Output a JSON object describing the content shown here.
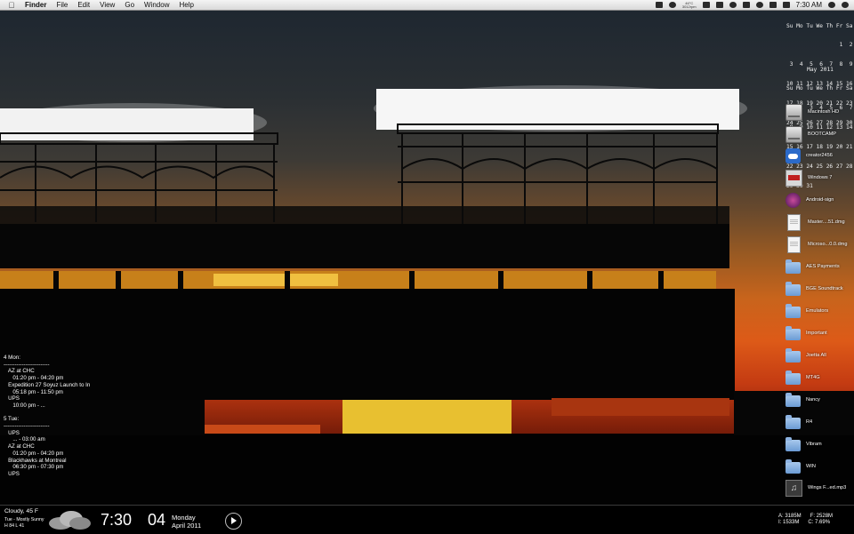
{
  "menubar": {
    "app_name": "Finder",
    "menus": [
      "File",
      "Edit",
      "View",
      "Go",
      "Window",
      "Help"
    ],
    "temp_line1": "46°C",
    "temp_line2": "3012rpm",
    "clock": "7:30 AM"
  },
  "calendars": [
    {
      "title": "",
      "header": "Su Mo Tu We Th Fr Sa",
      "weeks": [
        "                1  2",
        " 3  4  5  6  7  8  9",
        "10 11 12 13 14 15 16",
        "17 18 19 20 21 22 23",
        "24 25 26 27 28 29 30"
      ]
    },
    {
      "title": "May 2011",
      "header": "Su Mo Tu We Th Fr Sa",
      "weeks": [
        " 1  2  3  4  5  6  7",
        " 8  9 10 11 12 13 14",
        "15 16 17 18 19 20 21",
        "22 23 24 25 26 27 28",
        "29 30 31"
      ]
    }
  ],
  "desktop_icons": [
    {
      "label": "Macintosh HD",
      "icon": "hard-drive-icon"
    },
    {
      "label": "BOOTCAMP",
      "icon": "hard-drive-icon"
    },
    {
      "label": "creator2456",
      "icon": "cloud-drive-icon"
    },
    {
      "label": "Windows 7",
      "icon": "windows-drive-icon"
    },
    {
      "label": "Android-sign",
      "icon": "android-disc-icon"
    },
    {
      "label": "Master....51.dmg",
      "icon": "document-icon"
    },
    {
      "label": "Microso...0.0.dmg",
      "icon": "document-icon"
    },
    {
      "label": "AES Payments",
      "icon": "folder-icon"
    },
    {
      "label": "BGE Soundtrack",
      "icon": "folder-icon"
    },
    {
      "label": "Emulators",
      "icon": "folder-icon"
    },
    {
      "label": "Important",
      "icon": "folder-icon"
    },
    {
      "label": "Joetta All",
      "icon": "folder-icon"
    },
    {
      "label": "MT4G",
      "icon": "folder-icon"
    },
    {
      "label": "Nancy",
      "icon": "folder-icon"
    },
    {
      "label": "R4",
      "icon": "folder-icon"
    },
    {
      "label": "Vibram",
      "icon": "folder-icon"
    },
    {
      "label": "WIN",
      "icon": "folder-icon"
    },
    {
      "label": "Wings F...ed.mp3",
      "icon": "music-file-icon"
    }
  ],
  "events": [
    "4 Mon:",
    "-------------------------",
    "   AZ at CHC",
    "      01:20 pm - 04:20 pm",
    "   Expedition 27 Soyuz Launch to In",
    "      05:18 pm - 11:50 pm",
    "   UPS",
    "      10:00 pm - ...",
    "",
    "5 Tue:",
    "-------------------------",
    "   UPS",
    "      ... - 03:00 am",
    "   AZ at CHC",
    "      01:20 pm - 04:20 pm",
    "   Blackhawks at Montreal",
    "      06:30 pm - 07:30 pm",
    "   UPS"
  ],
  "weather": {
    "condition": "Cloudy, 45 F",
    "forecast": "Tue - Mostly Sunny",
    "high_low": "H 84  L 41"
  },
  "datetime": {
    "time": "7:30",
    "day": "04",
    "weekday": "Monday",
    "month_year": "April 2011"
  },
  "system_stats": {
    "a": "A: 3185M",
    "f": "F: 2528M",
    "i": "I: 1533M",
    "c": "C: 7.69%"
  }
}
